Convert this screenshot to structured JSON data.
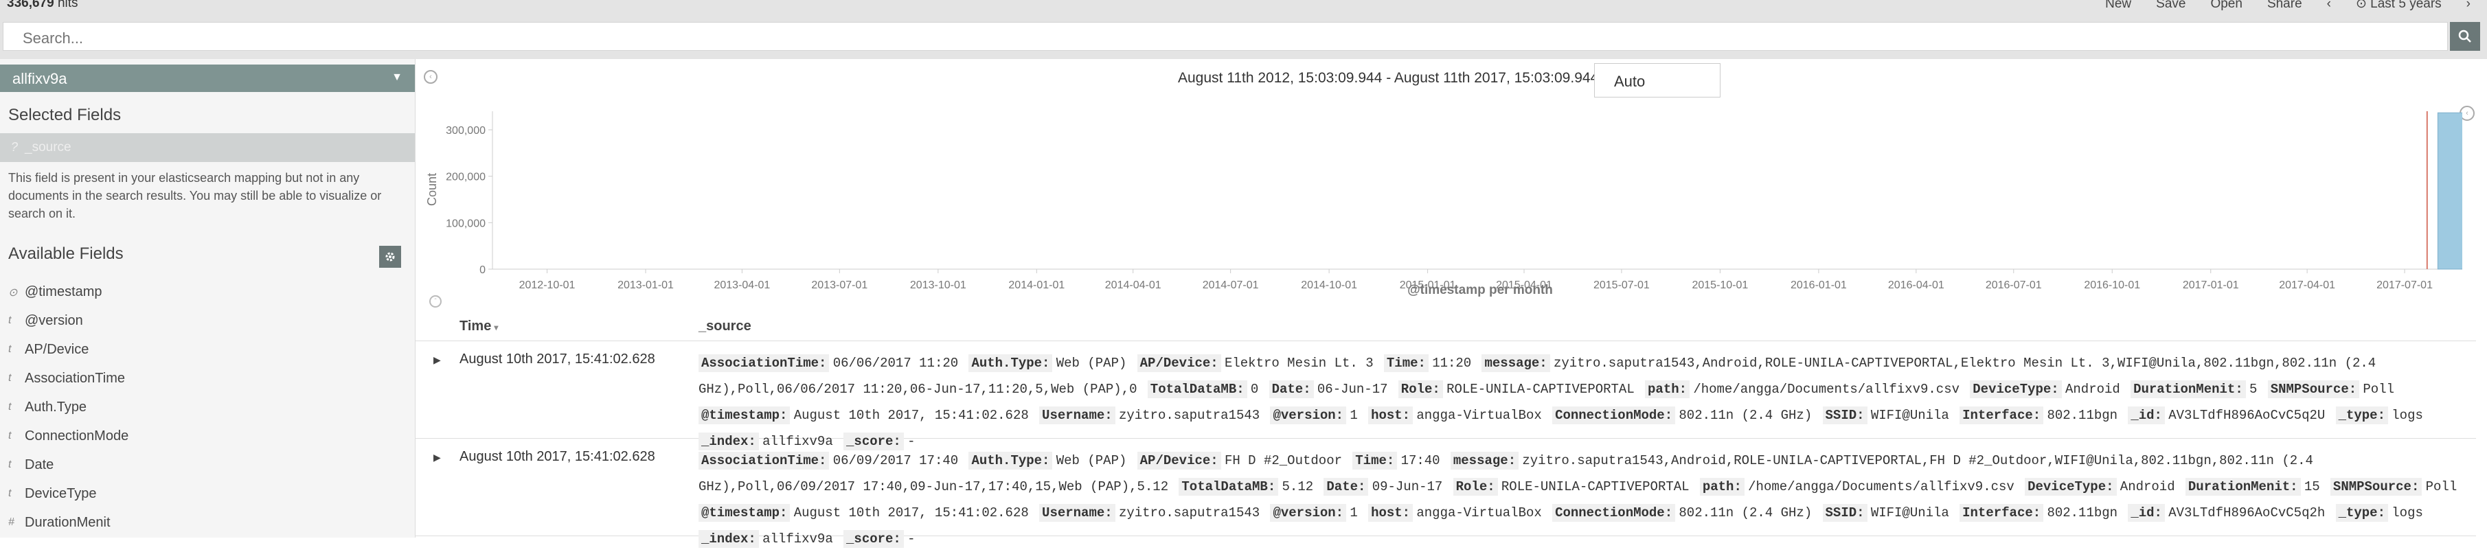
{
  "top": {
    "hits_count": "336,679",
    "hits_label": "hits",
    "menu": [
      "New",
      "Save",
      "Open",
      "Share"
    ],
    "time_label": "Last 5 years"
  },
  "search": {
    "placeholder": "Search..."
  },
  "sidebar": {
    "index_pattern": "allfixv9a",
    "selected_fields_title": "Selected Fields",
    "source_field_type": "?",
    "source_field": "_source",
    "source_note": "This field is present in your elasticsearch mapping but not in any documents in the search results. You may still be able to visualize or search on it.",
    "available_fields_title": "Available Fields",
    "fields": [
      {
        "type": "⊙",
        "name": "@timestamp"
      },
      {
        "type": "t",
        "name": "@version"
      },
      {
        "type": "t",
        "name": "AP/Device"
      },
      {
        "type": "t",
        "name": "AssociationTime"
      },
      {
        "type": "t",
        "name": "Auth.Type"
      },
      {
        "type": "t",
        "name": "ConnectionMode"
      },
      {
        "type": "t",
        "name": "Date"
      },
      {
        "type": "t",
        "name": "DeviceType"
      },
      {
        "type": "#",
        "name": "DurationMenit"
      }
    ]
  },
  "main": {
    "time_range": "August 11th 2012, 15:03:09.944 - August 11th 2017, 15:03:09.944 —",
    "interval": "Auto"
  },
  "chart_data": {
    "type": "bar",
    "ylabel": "Count",
    "xlabel": "@timestamp per month",
    "yticks": [
      "300,000",
      "200,000",
      "100,000",
      "0"
    ],
    "ylim": [
      0,
      340000
    ],
    "xticks": [
      "2012-10-01",
      "2013-01-01",
      "2013-04-01",
      "2013-07-01",
      "2013-10-01",
      "2014-01-01",
      "2014-04-01",
      "2014-07-01",
      "2014-10-01",
      "2015-01-01",
      "2015-04-01",
      "2015-07-01",
      "2015-10-01",
      "2016-01-01",
      "2016-04-01",
      "2016-07-01",
      "2016-10-01",
      "2017-01-01",
      "2017-04-01",
      "2017-07-01"
    ],
    "categories": [
      "2017-08-01"
    ],
    "values": [
      336679
    ],
    "bar_color": "#9ecae1"
  },
  "table": {
    "col_time": "Time",
    "col_source": "_source",
    "rows": [
      {
        "time": "August 10th 2017, 15:41:02.628",
        "pairs": [
          {
            "k": "AssociationTime:",
            "v": "06/06/2017 11:20"
          },
          {
            "k": "Auth.Type:",
            "v": "Web (PAP)"
          },
          {
            "k": "AP/Device:",
            "v": "Elektro Mesin Lt. 3"
          },
          {
            "k": "Time:",
            "v": "11:20"
          },
          {
            "k": "message:",
            "v": "zyitro.saputra1543,Android,ROLE-UNILA-CAPTIVEPORTAL,Elektro Mesin Lt. 3,WIFI@Unila,802.11bgn,802.11n (2.4 GHz),Poll,06/06/2017 11:20,06-Jun-17,11:20,5,Web (PAP),0"
          },
          {
            "k": "TotalDataMB:",
            "v": "0"
          },
          {
            "k": "Date:",
            "v": "06-Jun-17"
          },
          {
            "k": "Role:",
            "v": "ROLE-UNILA-CAPTIVEPORTAL"
          },
          {
            "k": "path:",
            "v": "/home/angga/Documents/allfixv9.csv"
          },
          {
            "k": "DeviceType:",
            "v": "Android"
          },
          {
            "k": "DurationMenit:",
            "v": "5"
          },
          {
            "k": "SNMPSource:",
            "v": "Poll"
          },
          {
            "k": "@timestamp:",
            "v": "August 10th 2017, 15:41:02.628"
          },
          {
            "k": "Username:",
            "v": "zyitro.saputra1543"
          },
          {
            "k": "@version:",
            "v": "1"
          },
          {
            "k": "host:",
            "v": "angga-VirtualBox"
          },
          {
            "k": "ConnectionMode:",
            "v": "802.11n (2.4 GHz)"
          },
          {
            "k": "SSID:",
            "v": "WIFI@Unila"
          },
          {
            "k": "Interface:",
            "v": "802.11bgn"
          },
          {
            "k": "_id:",
            "v": "AV3LTdfH896AoCvC5q2U"
          },
          {
            "k": "_type:",
            "v": "logs"
          },
          {
            "k": "_index:",
            "v": "allfixv9a"
          },
          {
            "k": "_score:",
            "v": "-"
          }
        ]
      },
      {
        "time": "August 10th 2017, 15:41:02.628",
        "pairs": [
          {
            "k": "AssociationTime:",
            "v": "06/09/2017 17:40"
          },
          {
            "k": "Auth.Type:",
            "v": "Web (PAP)"
          },
          {
            "k": "AP/Device:",
            "v": "FH D #2_Outdoor"
          },
          {
            "k": "Time:",
            "v": "17:40"
          },
          {
            "k": "message:",
            "v": "zyitro.saputra1543,Android,ROLE-UNILA-CAPTIVEPORTAL,FH D #2_Outdoor,WIFI@Unila,802.11bgn,802.11n (2.4 GHz),Poll,06/09/2017 17:40,09-Jun-17,17:40,15,Web (PAP),5.12"
          },
          {
            "k": "TotalDataMB:",
            "v": "5.12"
          },
          {
            "k": "Date:",
            "v": "09-Jun-17"
          },
          {
            "k": "Role:",
            "v": "ROLE-UNILA-CAPTIVEPORTAL"
          },
          {
            "k": "path:",
            "v": "/home/angga/Documents/allfixv9.csv"
          },
          {
            "k": "DeviceType:",
            "v": "Android"
          },
          {
            "k": "DurationMenit:",
            "v": "15"
          },
          {
            "k": "SNMPSource:",
            "v": "Poll"
          },
          {
            "k": "@timestamp:",
            "v": "August 10th 2017, 15:41:02.628"
          },
          {
            "k": "Username:",
            "v": "zyitro.saputra1543"
          },
          {
            "k": "@version:",
            "v": "1"
          },
          {
            "k": "host:",
            "v": "angga-VirtualBox"
          },
          {
            "k": "ConnectionMode:",
            "v": "802.11n (2.4 GHz)"
          },
          {
            "k": "SSID:",
            "v": "WIFI@Unila"
          },
          {
            "k": "Interface:",
            "v": "802.11bgn"
          },
          {
            "k": "_id:",
            "v": "AV3LTdfH896AoCvC5q2h"
          },
          {
            "k": "_type:",
            "v": "logs"
          },
          {
            "k": "_index:",
            "v": "allfixv9a"
          },
          {
            "k": "_score:",
            "v": "-"
          }
        ]
      }
    ]
  }
}
